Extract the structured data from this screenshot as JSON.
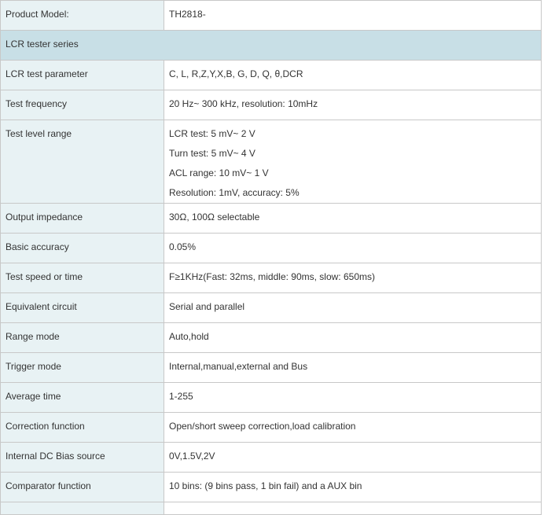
{
  "header": {
    "label": "Product Model:",
    "value": "TH2818-"
  },
  "section_title": "LCR tester series",
  "rows": [
    {
      "label": "LCR test parameter",
      "value": "C, L, R,Z,Y,X,B, G, D, Q, θ,DCR"
    },
    {
      "label": "Test frequency",
      "value": "20 Hz~ 300 kHz, resolution: 10mHz"
    }
  ],
  "level_range": {
    "label": "Test level range",
    "lines": [
      "LCR test:  5 mV~ 2 V",
      "Turn test:  5 mV~ 4 V",
      "ACL range:  10 mV~ 1 V",
      "Resolution: 1mV, accuracy: 5%"
    ]
  },
  "rows2": [
    {
      "label": "Output impedance",
      "value": "30Ω, 100Ω selectable"
    },
    {
      "label": "Basic accuracy",
      "value": "0.05%"
    },
    {
      "label": "Test speed or time",
      "value": "F≥1KHz(Fast: 32ms, middle: 90ms, slow: 650ms)"
    },
    {
      "label": "Equivalent circuit",
      "value": "Serial and parallel"
    },
    {
      "label": "Range mode",
      "value": "Auto,hold"
    },
    {
      "label": "Trigger mode",
      "value": "Internal,manual,external and Bus"
    },
    {
      "label": "Average time",
      "value": "1-255"
    },
    {
      "label": "Correction function",
      "value": "Open/short sweep correction,load calibration"
    },
    {
      "label": "Internal DC Bias source",
      "value": "0V,1.5V,2V"
    },
    {
      "label": "Comparator function",
      "value": "10 bins:  (9 bins pass, 1 bin fail) and a AUX bin"
    }
  ]
}
